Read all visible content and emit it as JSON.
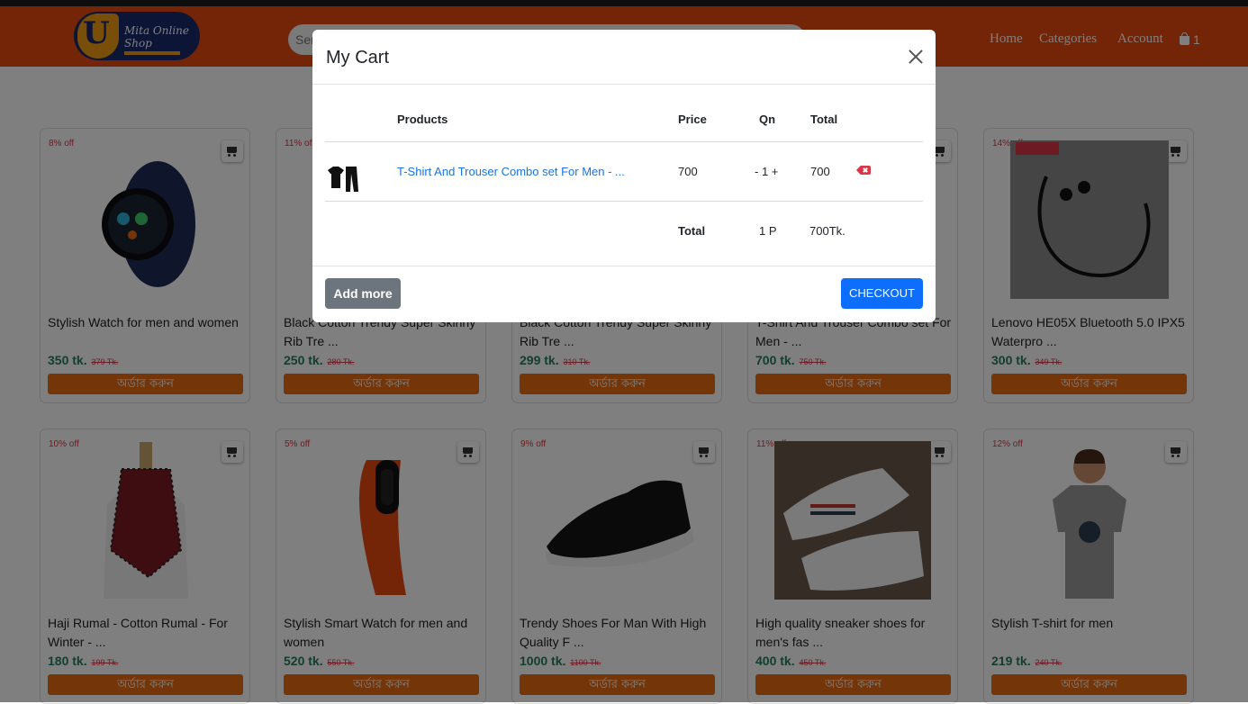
{
  "header": {
    "logo_text_1": "Mita Online",
    "logo_text_2": "Shop",
    "search_placeholder": "Ser",
    "nav": [
      "Home",
      "Categories",
      "Account"
    ],
    "cart_count": "1"
  },
  "order_label": "অর্ডার করুন",
  "products": [
    {
      "discount": "8% off",
      "title": "Stylish Watch for men and women",
      "price": "350 tk.",
      "old_price": "379 Tk.",
      "icon": "smartwatch-image"
    },
    {
      "discount": "11% off",
      "title": "Black Cotton Trendy Super Skinny Rib Tre ...",
      "price": "250 tk.",
      "old_price": "280 Tk.",
      "icon": "trouser-image"
    },
    {
      "discount": "",
      "title": "Black Cotton Trendy Super Skinny Rib Tre ...",
      "price": "299 tk.",
      "old_price": "310 Tk.",
      "icon": "trouser-image"
    },
    {
      "discount": "",
      "title": "T-Shirt And Trouser Combo set For Men - ...",
      "price": "700 tk.",
      "old_price": "750 Tk.",
      "icon": "combo-image"
    },
    {
      "discount": "14% off",
      "title": "Lenovo HE05X Bluetooth 5.0 IPX5 Waterpro ...",
      "price": "300 tk.",
      "old_price": "349 Tk.",
      "icon": "earphone-image"
    },
    {
      "discount": "10% off",
      "title": "Haji Rumal - Cotton Rumal - For Winter - ...",
      "price": "180 tk.",
      "old_price": "199 Tk.",
      "icon": "scarf-image"
    },
    {
      "discount": "5% off",
      "title": "Stylish Smart Watch for men and women",
      "price": "520 tk.",
      "old_price": "550 Tk.",
      "icon": "smartband-image"
    },
    {
      "discount": "9% off",
      "title": "Trendy Shoes For Man With High Quality F ...",
      "price": "1000 tk.",
      "old_price": "1100 Tk.",
      "icon": "sneaker-image"
    },
    {
      "discount": "11% off",
      "title": "High quality sneaker shoes for men's fas ...",
      "price": "400 tk.",
      "old_price": "450 Tk.",
      "icon": "white-sneaker-image"
    },
    {
      "discount": "12% off",
      "title": "Stylish T-shirt for men",
      "price": "219 tk.",
      "old_price": "240 Tk.",
      "icon": "tshirt-image"
    }
  ],
  "modal": {
    "title": "My Cart",
    "columns": {
      "products": "Products",
      "price": "Price",
      "qn": "Qn",
      "total": "Total"
    },
    "item": {
      "name": "T-Shirt And Trouser Combo set For Men - ...",
      "price": "700",
      "qty": "- 1 +",
      "total": "700"
    },
    "summary": {
      "label": "Total",
      "qty": "1 P",
      "amount": "700Tk."
    },
    "add_more": "Add more",
    "checkout": "CHECKOUT"
  },
  "colors": {
    "brand": "#e8490f",
    "order_button": "#e86b12",
    "checkout": "#0d6efd",
    "discount": "#dc3545"
  }
}
